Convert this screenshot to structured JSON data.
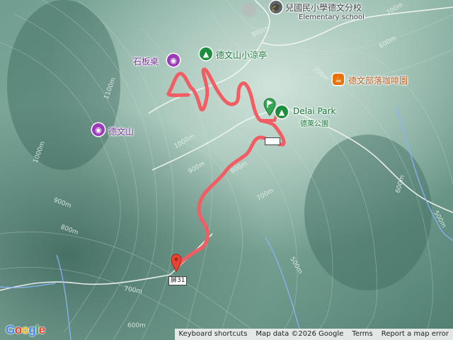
{
  "map": {
    "pois": [
      {
        "id": "school",
        "name": "兒國民小學德文分校",
        "sub": "Elementary school"
      },
      {
        "id": "pavilion",
        "name": "德文山小涼亭"
      },
      {
        "id": "slab",
        "name": "石板桌"
      },
      {
        "id": "mountain",
        "name": "德文山"
      },
      {
        "id": "park",
        "name": "Delai Park",
        "sub": "德萊公園"
      },
      {
        "id": "cafe",
        "name": "德文部落咖啡園"
      }
    ],
    "road_shield": "屏31",
    "contours": [
      "800m",
      "700m",
      "1100m",
      "1000m",
      "1000m",
      "900m",
      "800m",
      "700m",
      "900m",
      "800m",
      "700m",
      "600m",
      "500m",
      "700m",
      "600m",
      "500m",
      "600m"
    ],
    "colors": {
      "track": "#f25c63",
      "start": "#34a853",
      "end": "#ea4335",
      "road": "#ffffff",
      "river": "#8ab4f8"
    }
  },
  "footer": {
    "shortcuts": "Keyboard shortcuts",
    "data": "Map data ©2026 Google",
    "terms": "Terms",
    "report": "Report a map error"
  },
  "logo": "Google"
}
